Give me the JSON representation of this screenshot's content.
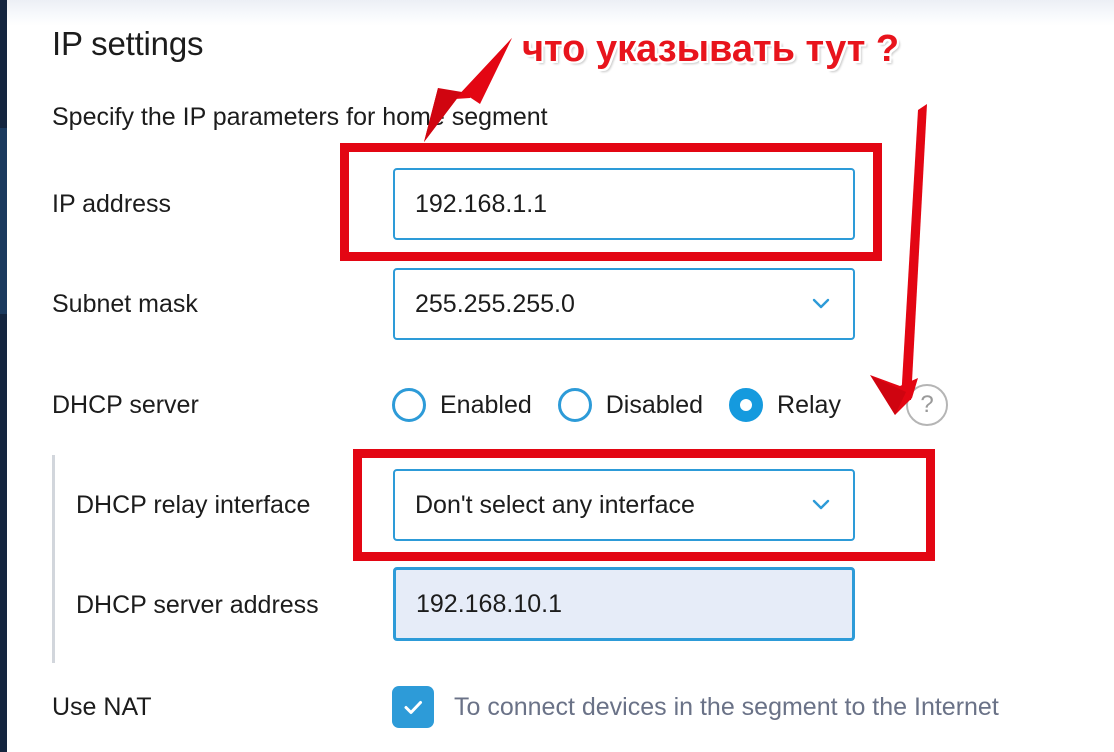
{
  "page": {
    "title": "IP settings",
    "subtitle": "Specify the IP parameters for home segment"
  },
  "rows": {
    "ip_address": {
      "label": "IP address",
      "value": "192.168.1.1"
    },
    "subnet_mask": {
      "label": "Subnet mask",
      "value": "255.255.255.0",
      "chevron_icon": "chevron-down-icon"
    },
    "dhcp_server": {
      "label": "DHCP server",
      "options": [
        {
          "label": "Enabled",
          "selected": false
        },
        {
          "label": "Disabled",
          "selected": false
        },
        {
          "label": "Relay",
          "selected": true
        }
      ],
      "help_icon": "question-mark-icon",
      "help_glyph": "?"
    },
    "dhcp_relay_interface": {
      "label": "DHCP relay interface",
      "value": "Don't select any interface",
      "chevron_icon": "chevron-down-icon"
    },
    "dhcp_server_address": {
      "label": "DHCP server address",
      "value": "192.168.10.1",
      "focused": true
    },
    "use_nat": {
      "label": "Use NAT",
      "checkbox_checked": true,
      "checkbox_icon": "checkmark-icon",
      "description": "To connect devices in the segment to the Internet"
    }
  },
  "annotations": {
    "question_text": "что указывать тут ?",
    "highlight_color": "#e30613",
    "arrow_color": "#e30613",
    "arrow_1_name": "red-arrow-to-ip-address",
    "arrow_2_name": "red-arrow-to-relay"
  },
  "theme": {
    "accent": "#2d9bd8",
    "radio_selected": "#159ade",
    "rail_dark": "#14253f",
    "rail_light": "#1b3a5e",
    "text": "#1c1c1c",
    "muted_text": "#6a7287",
    "focus_bg": "#e6ecf8"
  }
}
